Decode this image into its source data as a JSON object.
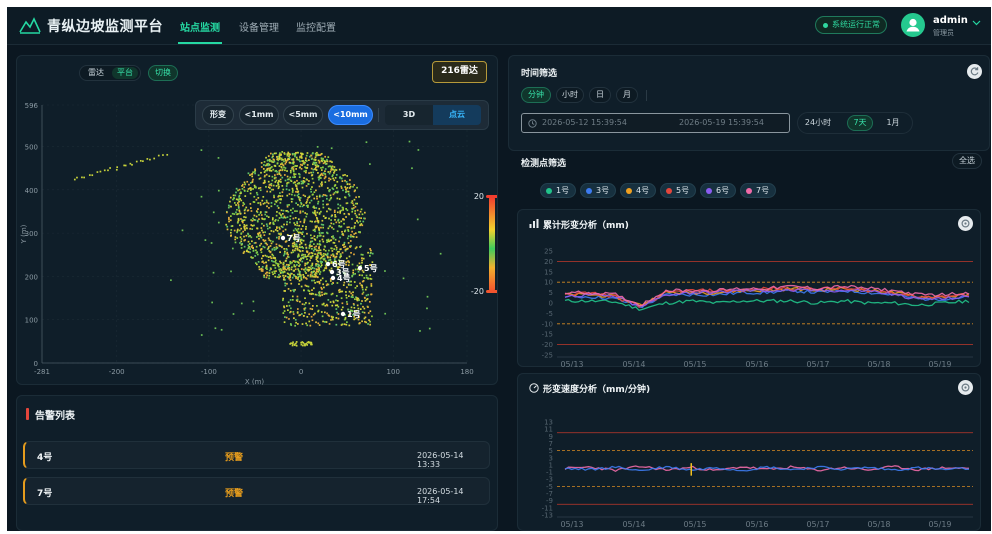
{
  "app": {
    "title": "青纵边坡监测平台"
  },
  "nav": {
    "items": [
      "站点监测",
      "设备管理",
      "监控配置"
    ],
    "active": 0
  },
  "status": {
    "label": "系统运行正常",
    "color": "#2fd89f"
  },
  "user": {
    "name": "admin",
    "role": "管理员"
  },
  "viewer": {
    "toggle": {
      "left": "雷达",
      "right": "平台",
      "action": "切换"
    },
    "scan_label": "216雷达",
    "controls": {
      "label": "形变",
      "options": [
        "<1mm",
        "<5mm",
        "<10mm"
      ],
      "selected": 2
    },
    "view_modes": [
      "3D",
      "点云"
    ],
    "view_mode_selected": 1,
    "x_axis": {
      "label": "X (m)",
      "ticks": [
        "-281",
        "-200",
        "-100",
        "0",
        "100",
        "180"
      ]
    },
    "y_axis": {
      "label": "Y (m)",
      "ticks": [
        "0",
        "100",
        "200",
        "300",
        "400",
        "500",
        "596"
      ]
    },
    "colorbar": {
      "max": "20",
      "min": "-20"
    },
    "markers": [
      "7号",
      "6号",
      "5号",
      "3号",
      "4号",
      "1号"
    ]
  },
  "alerts": {
    "title": "告警列表",
    "items": [
      {
        "name": "4号",
        "level": "预警",
        "time": "2026-05-14 13:33"
      },
      {
        "name": "7号",
        "level": "预警",
        "time": "2026-05-14 17:54"
      }
    ]
  },
  "time_filter": {
    "title": "时间筛选",
    "units": [
      "分钟",
      "小时",
      "日",
      "月"
    ],
    "unit_selected": 0,
    "start": "2026-05-12 15:39:54",
    "end": "2026-05-19 15:39:54",
    "quick": [
      "24小时",
      "7天",
      "1月"
    ],
    "quick_selected": 1
  },
  "point_filter": {
    "title": "检测点筛选",
    "select_all": "全选",
    "points": [
      {
        "label": "1号",
        "color": "#21c38a"
      },
      {
        "label": "3号",
        "color": "#3d7bf0"
      },
      {
        "label": "4号",
        "color": "#f0a020"
      },
      {
        "label": "5号",
        "color": "#e4463c"
      },
      {
        "label": "6号",
        "color": "#8b5cf0"
      },
      {
        "label": "7号",
        "color": "#f06aa8"
      }
    ]
  },
  "chart_data": [
    {
      "type": "line",
      "title": "累计形变分析（mm)",
      "x_labels": [
        "05/13",
        "05/14",
        "05/15",
        "05/16",
        "05/17",
        "05/18",
        "05/19"
      ],
      "y_ticks": [
        25,
        20,
        15,
        10,
        5,
        0,
        -5,
        -10,
        -15,
        -20,
        -25
      ],
      "ylim": [
        -25,
        25
      ],
      "thresholds": {
        "red": [
          20,
          -20
        ],
        "orange": [
          10,
          -10
        ]
      },
      "series": [
        {
          "color": "#21c38a",
          "values": [
            1,
            1,
            0.5,
            -3,
            0,
            1,
            0,
            1,
            1,
            1,
            0,
            1,
            0,
            0,
            -1,
            0,
            1
          ]
        },
        {
          "color": "#3d7bf0",
          "values": [
            3,
            3,
            2,
            -2,
            4,
            4,
            4,
            5,
            5,
            6,
            5,
            6,
            5,
            4,
            2,
            2,
            3
          ]
        },
        {
          "color": "#f0a020",
          "values": [
            4,
            4,
            3,
            -1,
            5,
            5,
            5,
            6,
            6,
            7,
            6,
            7,
            6,
            5,
            3,
            3,
            4
          ]
        },
        {
          "color": "#e4463c",
          "values": [
            4,
            5,
            3,
            -2,
            5,
            6,
            6,
            6,
            7,
            7,
            7,
            7,
            6,
            5,
            3,
            3,
            4
          ]
        },
        {
          "color": "#8b5cf0",
          "values": [
            3,
            4,
            3,
            -2,
            4,
            5,
            5,
            6,
            6,
            6,
            6,
            6,
            6,
            4,
            2,
            2,
            3
          ]
        },
        {
          "color": "#f06aa8",
          "values": [
            5,
            5,
            4,
            -1,
            6,
            6,
            6,
            7,
            7,
            8,
            7,
            8,
            7,
            6,
            4,
            4,
            5
          ]
        }
      ]
    },
    {
      "type": "line",
      "title": "形变速度分析（mm/分钟)",
      "x_labels": [
        "05/13",
        "05/14",
        "05/15",
        "05/16",
        "05/17",
        "05/18",
        "05/19"
      ],
      "y_ticks": [
        13,
        11,
        9,
        7,
        5,
        3,
        1,
        -1,
        -3,
        -5,
        -7,
        -9,
        -11,
        -13
      ],
      "ylim": [
        -13,
        13
      ],
      "thresholds": {
        "red": [
          10,
          -10
        ],
        "orange": [
          5,
          -5
        ]
      },
      "series": [
        {
          "color": "#f06aa8",
          "values": [
            0,
            0.4,
            -0.5,
            0.6,
            -0.4,
            0.3,
            -0.6,
            0.5,
            -0.3,
            0.4,
            -0.5,
            0.3,
            -0.4,
            0.5,
            -0.3,
            0.2,
            0
          ]
        },
        {
          "color": "#3d7bf0",
          "values": [
            0,
            -0.3,
            0.4,
            -0.6,
            0.5,
            -0.4,
            0.3,
            -0.5,
            0.4,
            -0.3,
            0.4,
            -0.2,
            0.3,
            -0.4,
            0.2,
            -0.3,
            0
          ]
        }
      ],
      "spike": {
        "index": 5,
        "min": -2,
        "max": 1.5,
        "color": "#f0c020"
      }
    }
  ]
}
